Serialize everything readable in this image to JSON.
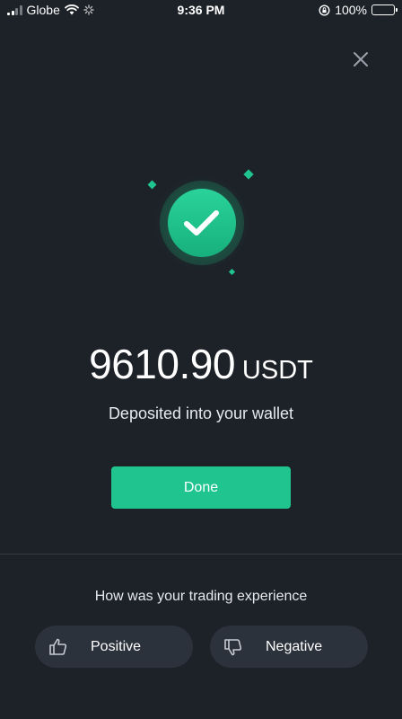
{
  "status_bar": {
    "carrier": "Globe",
    "time": "9:36 PM",
    "battery_percent": "100%",
    "battery_level": 1.0
  },
  "close": {
    "icon": "close-icon"
  },
  "deposit": {
    "amount": "9610.90",
    "currency": "USDT",
    "message": "Deposited into your wallet"
  },
  "done_button": {
    "label": "Done"
  },
  "feedback": {
    "question": "How was your trading experience",
    "positive_label": "Positive",
    "negative_label": "Negative"
  },
  "colors": {
    "background": "#1d2229",
    "accent": "#1fc48e",
    "button_dark": "#2b323b"
  }
}
